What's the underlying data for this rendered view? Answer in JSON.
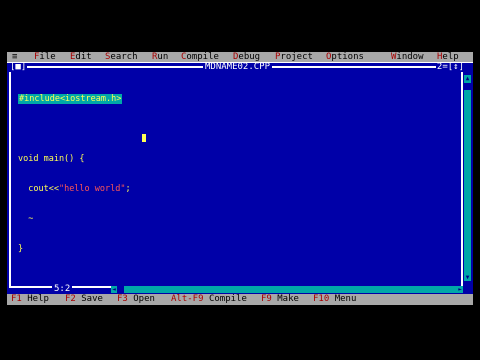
{
  "menubar": {
    "system": "≡",
    "items": [
      {
        "hot": "F",
        "rest": "ile"
      },
      {
        "hot": "E",
        "rest": "dit"
      },
      {
        "hot": "S",
        "rest": "earch"
      },
      {
        "hot": "R",
        "rest": "un"
      },
      {
        "hot": "C",
        "rest": "ompile"
      },
      {
        "hot": "D",
        "rest": "ebug"
      },
      {
        "hot": "P",
        "rest": "roject"
      },
      {
        "hot": "O",
        "rest": "ptions"
      },
      {
        "hot": "W",
        "rest": "indow"
      },
      {
        "hot": "H",
        "rest": "elp"
      }
    ]
  },
  "editor": {
    "close": "[■]",
    "title": "MDNAME02.CPP",
    "window_number": "2=[↕]",
    "code": {
      "line1": "#include<iostream.h>",
      "line2_kw": "void main() {",
      "line3_pre": "  cout<<",
      "line3_str": "\"hello world\"",
      "line3_post": ";",
      "line4": "  ~",
      "line5": "}"
    },
    "position": "5:2"
  },
  "statusbar": [
    {
      "key": "F1",
      "label": "Help"
    },
    {
      "key": "F2",
      "label": "Save"
    },
    {
      "key": "F3",
      "label": "Open"
    },
    {
      "key": "Alt-F9",
      "label": "Compile"
    },
    {
      "key": "F9",
      "label": "Make"
    },
    {
      "key": "F10",
      "label": "Menu"
    }
  ]
}
